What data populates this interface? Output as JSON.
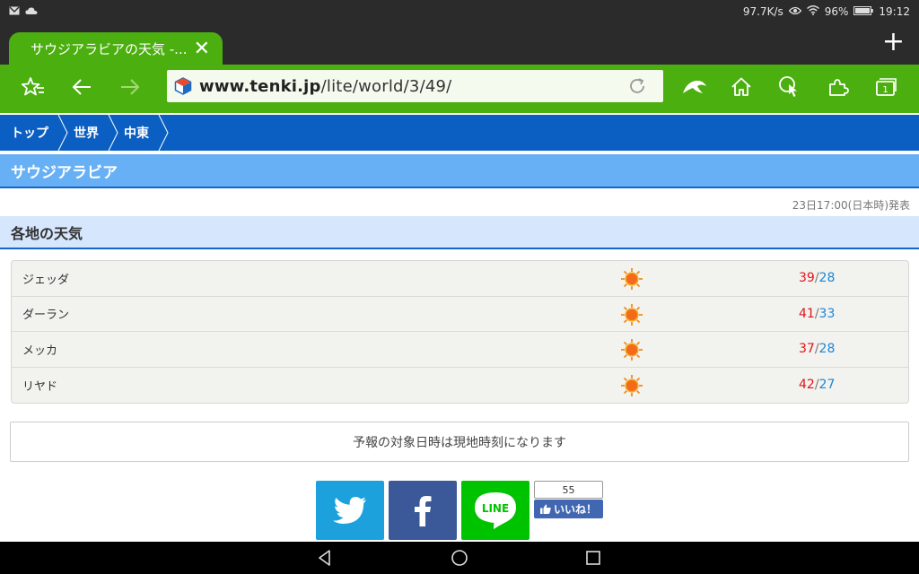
{
  "status": {
    "net_speed": "97.7K/s",
    "battery": "96%",
    "time": "19:12"
  },
  "tab": {
    "title": "サウジアラビアの天気 -..."
  },
  "toolbar": {
    "url_host": "www.tenki.jp",
    "url_path": "/lite/world/3/49/"
  },
  "breadcrumb": [
    "トップ",
    "世界",
    "中東"
  ],
  "region_title": "サウジアラビア",
  "issued": "23日17:00(日本時)発表",
  "section_title": "各地の天気",
  "cities": [
    {
      "name": "ジェッダ",
      "high": "39",
      "low": "28",
      "weather": "sun-icon"
    },
    {
      "name": "ダーラン",
      "high": "41",
      "low": "33",
      "weather": "sun-icon"
    },
    {
      "name": "メッカ",
      "high": "37",
      "low": "28",
      "weather": "sun-icon"
    },
    {
      "name": "リヤド",
      "high": "42",
      "low": "27",
      "weather": "sun-icon"
    }
  ],
  "temp_separator": "/",
  "note": "予報の対象日時は現地時刻になります",
  "share": {
    "line_label": "LINE",
    "like_count": "55",
    "like_label": "いいね！"
  },
  "colors": {
    "browser_green": "#4caf10",
    "breadcrumb_blue": "#0c5fc2",
    "region_blue": "#67b0f5",
    "high_red": "#e0141c",
    "low_blue": "#1a86d9",
    "twitter": "#1da1dc",
    "facebook": "#3b5998",
    "line": "#00c300"
  }
}
